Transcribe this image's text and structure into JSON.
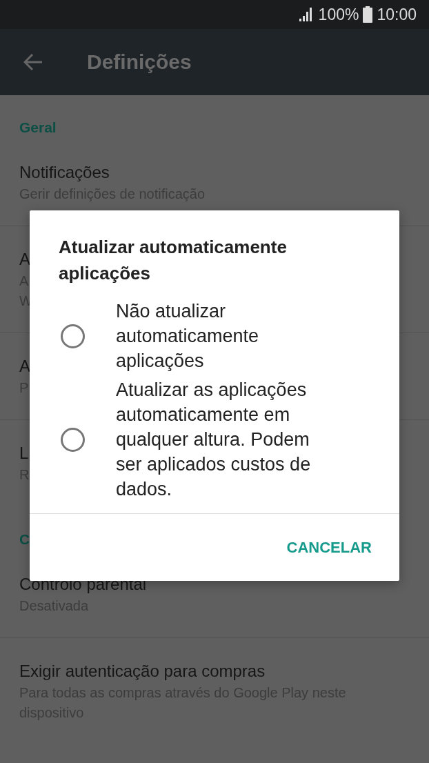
{
  "status_bar": {
    "battery": "100%",
    "time": "10:00"
  },
  "toolbar": {
    "title": "Definições"
  },
  "sections": [
    {
      "header": "Geral",
      "items": [
        {
          "title": "Notificações",
          "summary": [
            "Gerir definições de notificação"
          ]
        },
        {
          "title": "A",
          "summary": [
            "A",
            "W"
          ]
        },
        {
          "title": "A",
          "summary": [
            "P"
          ]
        },
        {
          "title": "L",
          "summary": [
            "R"
          ]
        }
      ]
    },
    {
      "header": "C",
      "items": [
        {
          "title": "Controlo parental",
          "summary": [
            "Desativada"
          ]
        },
        {
          "title": "Exigir autenticação para compras",
          "summary": [
            "Para todas as compras através do Google Play neste",
            "dispositivo"
          ]
        }
      ]
    }
  ],
  "dialog": {
    "title": "Atualizar automaticamente aplicações",
    "options": [
      {
        "label": "Não atualizar automaticamente aplicações",
        "selected": false
      },
      {
        "label": "Atualizar as aplicações automaticamente em qualquer altura. Podem ser aplicados custos de dados.",
        "selected": false
      }
    ],
    "buttons": [
      "CANCELAR"
    ]
  }
}
